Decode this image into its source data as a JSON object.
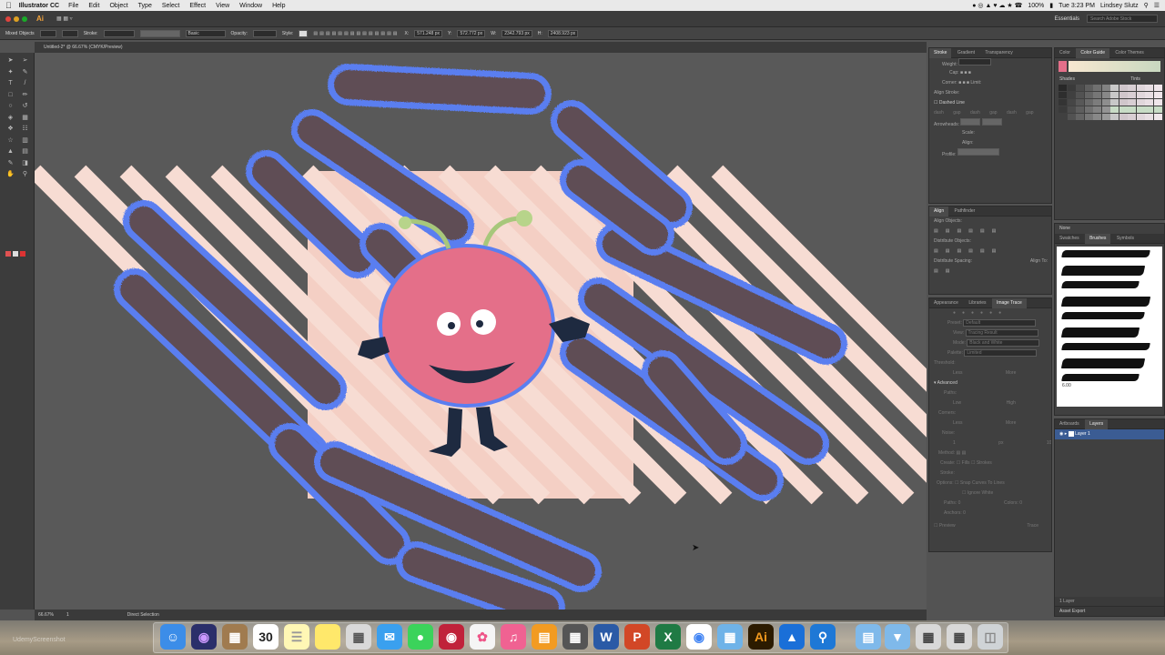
{
  "menubar": {
    "apple": "",
    "app": "Illustrator CC",
    "items": [
      "File",
      "Edit",
      "Object",
      "Type",
      "Select",
      "Effect",
      "View",
      "Window",
      "Help"
    ],
    "battery": "100%",
    "clock": "Tue 3:23 PM",
    "user": "Lindsey Slutz"
  },
  "appbar": {
    "logo": "Ai",
    "workspace": "Essentials",
    "search_placeholder": "Search Adobe Stock"
  },
  "control": {
    "selection": "Mixed Objects",
    "stroke_label": "Stroke:",
    "brush": "Basic",
    "opacity_label": "Opacity:",
    "style_label": "Style:",
    "x": "571.248 px",
    "y": "572.772 px",
    "w": "2342.793 px",
    "h": "2408.923 px"
  },
  "doc_tab": "Untitled-2* @ 66.67% (CMYK/Preview)",
  "status": {
    "zoom": "66.67%",
    "artboard": "1",
    "tool": "Direct Selection"
  },
  "stroke_panel": {
    "tabs": [
      "Stroke",
      "Gradient",
      "Transparency"
    ],
    "rows": [
      "Weight:",
      "Cap:",
      "Corner:",
      "Align Stroke:"
    ],
    "limit": "Limit:",
    "dashed": "Dashed Line",
    "dash_labels": [
      "dash",
      "gap",
      "dash",
      "gap",
      "dash",
      "gap"
    ],
    "rows2": [
      "Arrowheads:",
      "Scale:",
      "Align:",
      "Profile:"
    ]
  },
  "align_panel": {
    "tabs": [
      "Align",
      "Pathfinder"
    ],
    "labels": [
      "Align Objects:",
      "Distribute Objects:",
      "Distribute Spacing:"
    ],
    "align_to": "Align To:"
  },
  "trace_panel": {
    "tabs": [
      "Appearance",
      "Libraries",
      "Image Trace"
    ],
    "preset": "Preset:",
    "preset_val": "Default",
    "view": "View:",
    "view_val": "Tracing Result",
    "mode": "Mode:",
    "mode_val": "Black and White",
    "palette": "Palette:",
    "palette_val": "Limited",
    "threshold": "Threshold:",
    "less": "Less",
    "more": "More",
    "advanced": "Advanced",
    "paths": "Paths:",
    "low": "Low",
    "high": "High",
    "corners": "Corners:",
    "noise": "Noise:",
    "noise_val": "1 px",
    "noise_max": "100",
    "method": "Method:",
    "create": "Create:",
    "fills": "Fills",
    "strokes": "Strokes",
    "stroke_opt": "Stroke:",
    "options": "Options:",
    "snap": "Snap Curves To Lines",
    "ignore": "Ignore White",
    "paths_count": "Paths:",
    "anchors": "Anchors:",
    "colors": "Colors:",
    "count_val": "0",
    "preview": "Preview",
    "trace": "Trace"
  },
  "color_panel": {
    "tabs": [
      "Color",
      "Color Guide",
      "Color Themes"
    ],
    "shades": "Shades",
    "tints": "Tints"
  },
  "brushes_panel": {
    "tabs": [
      "Swatches",
      "Brushes",
      "Symbols"
    ],
    "none_label": "None",
    "size": "6.00"
  },
  "layers_panel": {
    "tabs": [
      "Artboards",
      "Layers"
    ],
    "layer_name": "Layer 1",
    "count": "1 Layer"
  },
  "asset_export": "Asset Export",
  "watermark": "UdemyScreenshot",
  "dock": {
    "calendar_month": "MAY",
    "calendar_day": "30",
    "ai": "Ai",
    "word": "W",
    "excel": "X"
  },
  "colors": {
    "artboard": "#f4cfc4",
    "stroke_blue": "#5a7ef0",
    "dark_stroke": "#5e4e55",
    "monster": "#e46f89",
    "accent": "#4a90e2"
  }
}
